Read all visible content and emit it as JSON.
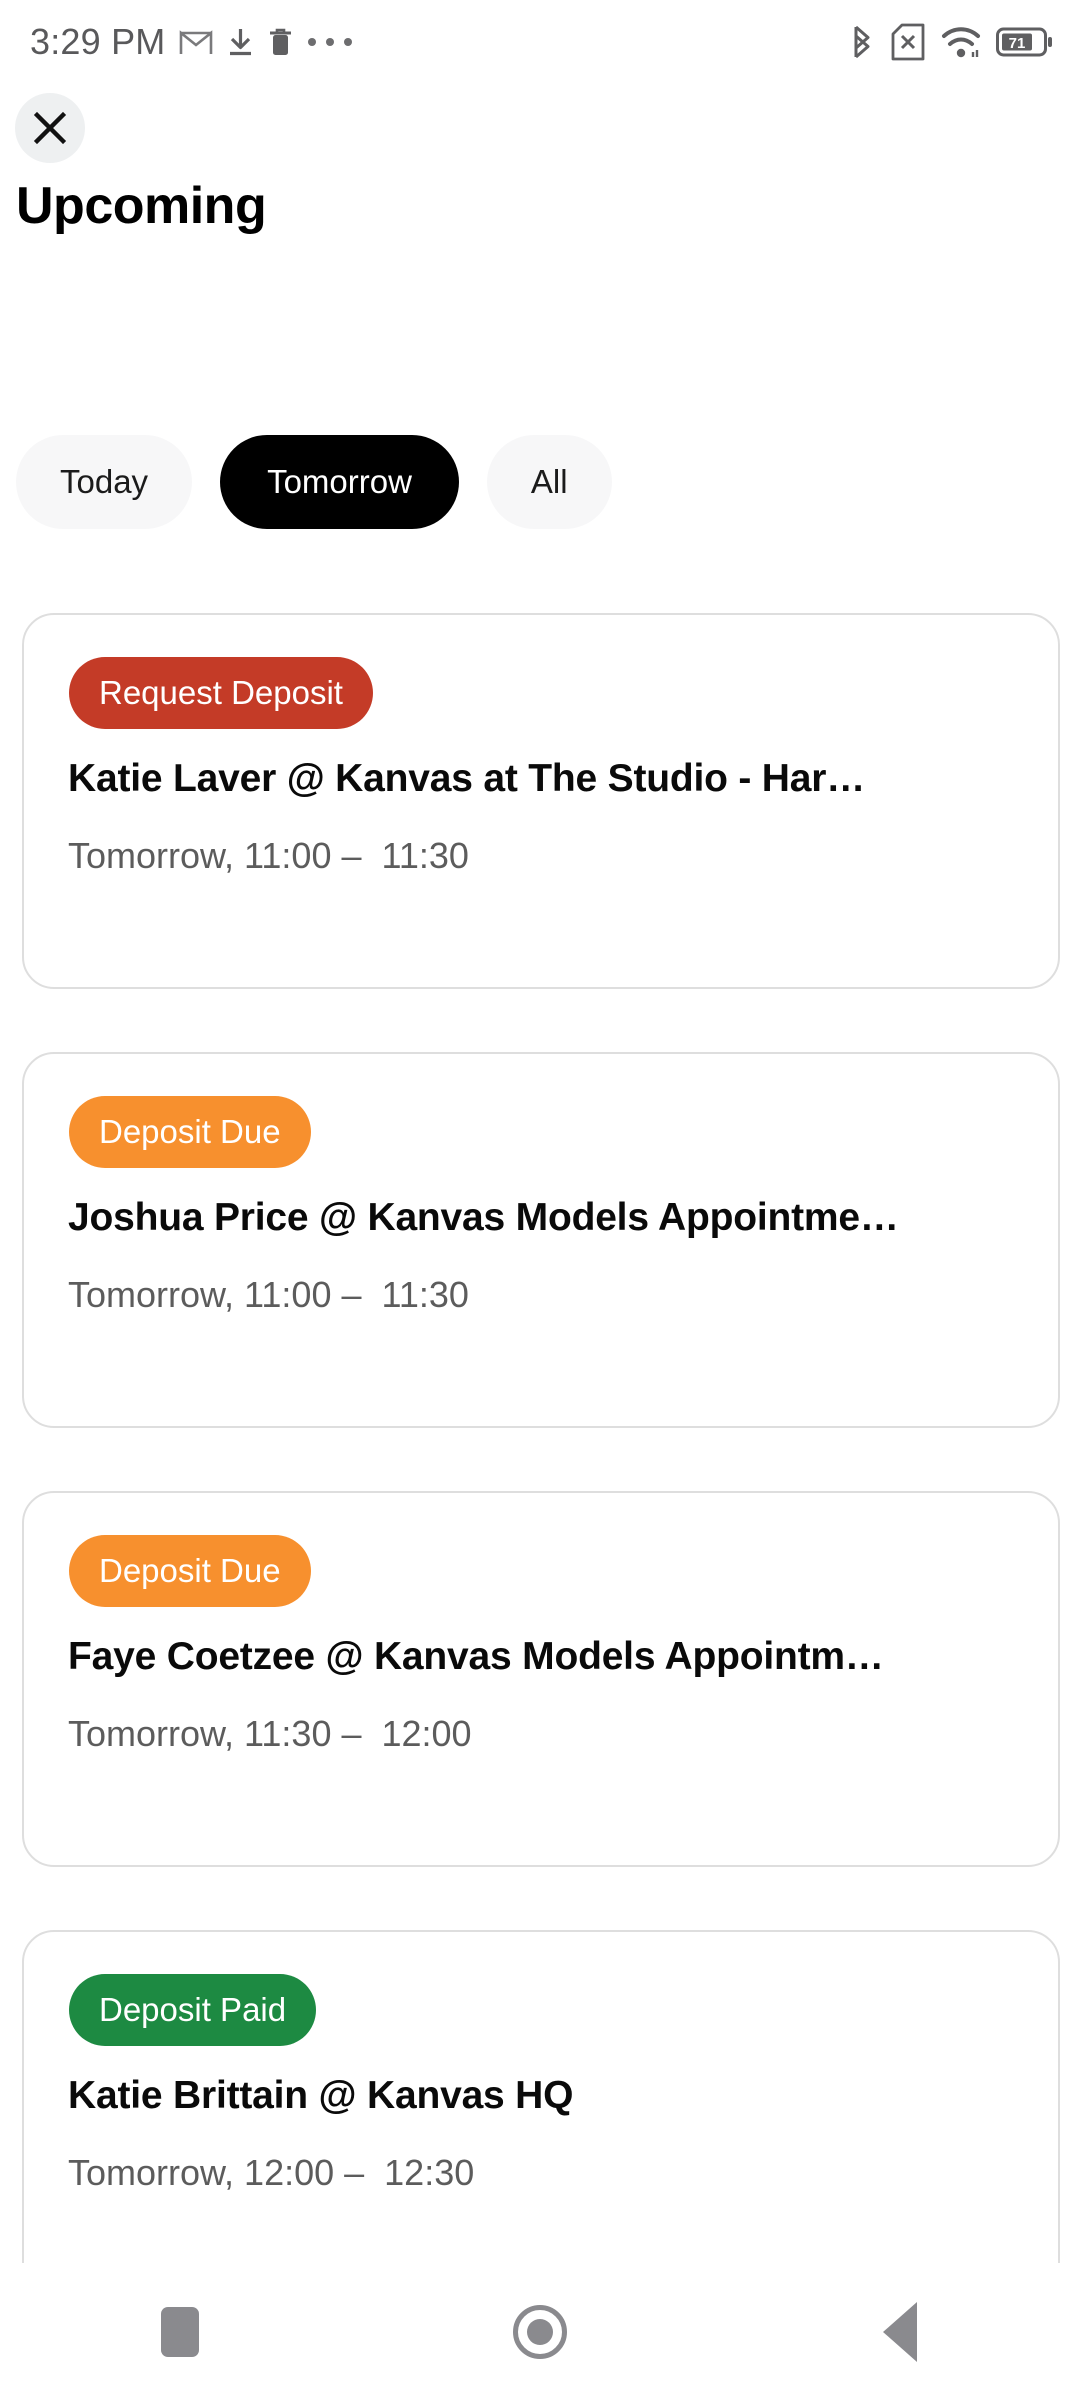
{
  "status_bar": {
    "clock": "3:29 PM",
    "left_icons": [
      "gmail-icon",
      "download-icon",
      "trash-icon",
      "overflow-dots-icon"
    ],
    "right_icons": [
      "bluetooth-icon",
      "sim-missing-icon",
      "wifi-icon",
      "battery-icon"
    ],
    "battery_level": "71"
  },
  "header": {
    "close_icon": "close-icon",
    "title": "Upcoming"
  },
  "filters": {
    "chips": [
      {
        "label": "Today",
        "selected": false
      },
      {
        "label": "Tomorrow",
        "selected": true
      },
      {
        "label": "All",
        "selected": false
      }
    ],
    "selected_bg": "#000000",
    "unselected_bg": "#f7f7f8"
  },
  "colors": {
    "request_deposit": "#c43b27",
    "deposit_due": "#f7902e",
    "deposit_paid": "#1d8a42",
    "card_border": "#dedede",
    "time_text": "#5c5c5c"
  },
  "appointments": [
    {
      "badge": "Request Deposit",
      "badge_color": "#c43b27",
      "title": "Katie   Laver @ Kanvas at The Studio - Har…",
      "time": "Tomorrow, 11:00 –  11:30"
    },
    {
      "badge": "Deposit Due",
      "badge_color": "#f7902e",
      "title": "Joshua Price @ Kanvas Models Appointme…",
      "time": "Tomorrow, 11:00 –  11:30"
    },
    {
      "badge": "Deposit Due",
      "badge_color": "#f7902e",
      "title": "Faye  Coetzee @ Kanvas Models Appointm…",
      "time": "Tomorrow, 11:30 –  12:00"
    },
    {
      "badge": "Deposit Paid",
      "badge_color": "#1d8a42",
      "title": "Katie Brittain @ Kanvas HQ",
      "time": "Tomorrow, 12:00 –  12:30"
    }
  ],
  "nav_bar": {
    "recents_icon": "square-recents-icon",
    "home_icon": "circle-home-icon",
    "back_icon": "triangle-back-icon"
  }
}
